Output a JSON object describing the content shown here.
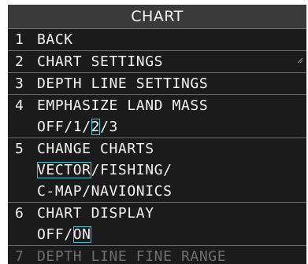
{
  "title": "CHART",
  "items": [
    {
      "num": "1",
      "label": "BACK"
    },
    {
      "num": "2",
      "label": "CHART SETTINGS"
    },
    {
      "num": "3",
      "label": "DEPTH LINE SETTINGS"
    },
    {
      "num": "4",
      "label": "EMPHASIZE LAND MASS",
      "options": [
        "OFF",
        "1",
        "2",
        "3"
      ],
      "selected": "2"
    },
    {
      "num": "5",
      "label": "CHANGE CHARTS",
      "options_line1": [
        "VECTOR",
        "FISHING",
        ""
      ],
      "options_line2": [
        "C-MAP",
        "NAVIONICS"
      ],
      "selected": "VECTOR"
    },
    {
      "num": "6",
      "label": "CHART DISPLAY",
      "options": [
        "OFF",
        "ON"
      ],
      "selected": "ON"
    },
    {
      "num": "7",
      "label": "DEPTH LINE FINE RANGE"
    }
  ],
  "sep": "/",
  "colors": {
    "background": "#1b1b1b",
    "title_background": "#3a3a3a",
    "text": "#f2f2f2",
    "selection_outline": "#41c4d8",
    "disabled_text": "#6e6e6e"
  }
}
